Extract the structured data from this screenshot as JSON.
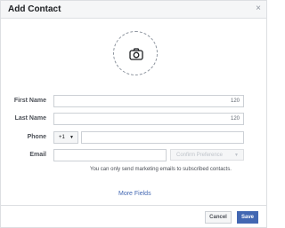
{
  "dialog": {
    "title": "Add Contact",
    "close_label": "×"
  },
  "photo": {
    "icon": "camera-icon"
  },
  "form": {
    "first_name": {
      "label": "First Name",
      "value": "",
      "counter": "120"
    },
    "last_name": {
      "label": "Last Name",
      "value": "",
      "counter": "120"
    },
    "phone": {
      "label": "Phone",
      "country_code": "+1",
      "caret": "▼",
      "value": ""
    },
    "email": {
      "label": "Email",
      "value": "",
      "preference_placeholder": "Confirm Preference",
      "caret": "▼"
    },
    "note": "You can only send marketing emails to subscribed contacts."
  },
  "more_fields_label": "More Fields",
  "footer": {
    "cancel_label": "Cancel",
    "save_label": "Save"
  },
  "colors": {
    "accent": "#4267b2",
    "border": "#ccd0d5",
    "header_bg": "#f5f6f7"
  }
}
